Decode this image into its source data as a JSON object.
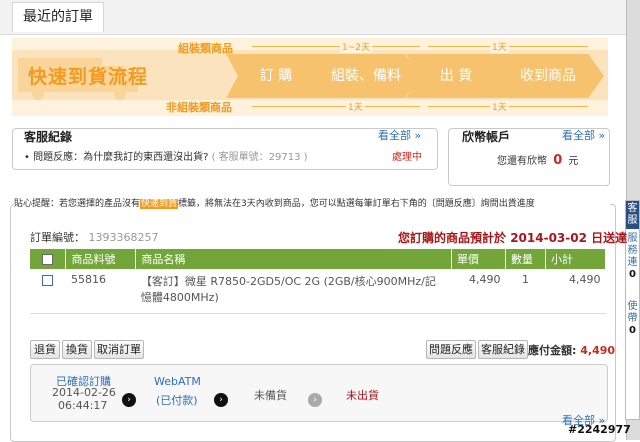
{
  "page": {
    "title": "最近的訂單"
  },
  "flow": {
    "heading": "快速到貨流程",
    "top_label": "組裝類商品",
    "bottom_label": "非組裝類商品",
    "top_durations": [
      "1~2天",
      "1天"
    ],
    "bottom_durations": [
      "1天",
      "1天"
    ],
    "steps": [
      "訂 購",
      "組裝、備料",
      "出 貨",
      "收到商品"
    ]
  },
  "service": {
    "title": "客服紀錄",
    "see_all": "看全部 »",
    "item_text": "問題反應：為什麼我訂的東西還沒出貨?",
    "ticket": "( 客服單號：29713 )",
    "status": "處理中"
  },
  "account": {
    "title": "欣幣帳戶",
    "see_all": "看全部 »",
    "balance_label": "您還有欣幣",
    "balance": "0",
    "unit": "元"
  },
  "notice": {
    "prefix": "貼心提醒：若您選擇的產品沒有",
    "tag": "快速到貨",
    "suffix": "標籤，將無法在3天內收到商品，您可以點選每筆訂單右下角的〔問題反應〕詢問出貨進度"
  },
  "order": {
    "number_label": "訂單編號：",
    "number": "1393368257",
    "eta_label": "您訂購的商品預計於",
    "eta_date": "2014-03-02",
    "eta_suffix": "日送達",
    "columns": [
      "商品料號",
      "商品名稱",
      "單價",
      "數量",
      "小計"
    ],
    "items": [
      {
        "sku": "55816",
        "name": "【客訂】微星 R7850-2GD5/OC 2G (2GB/核心900MHz/記憶體4800MHz)",
        "price": "4,490",
        "qty": "1",
        "subtotal": "4,490"
      }
    ],
    "buttons_left": [
      "退貨",
      "換貨",
      "取消訂單"
    ],
    "buttons_right": [
      "問題反應",
      "客服紀錄"
    ],
    "total_label": "應付金額:",
    "total": "4,490"
  },
  "tracking": {
    "steps": [
      {
        "title": "已確認訂購",
        "date": "2014-02-26",
        "time": "06:44:17"
      },
      {
        "title": "WebATM",
        "sub": "(已付款)"
      },
      {
        "title": "未備貨"
      },
      {
        "title": "未出貨"
      }
    ]
  },
  "bottom": {
    "see_all": "看全部 »"
  },
  "side_tab": {
    "top_text": "客服",
    "lines": [
      "服務",
      "連",
      "0",
      "使",
      "帶",
      "0"
    ]
  },
  "watermark": "#2242977",
  "colors": {
    "accent_orange": "#f39a1f",
    "table_header": "#73a63a",
    "alert_red": "#cc2a1a",
    "link_blue": "#2f6fb5"
  }
}
